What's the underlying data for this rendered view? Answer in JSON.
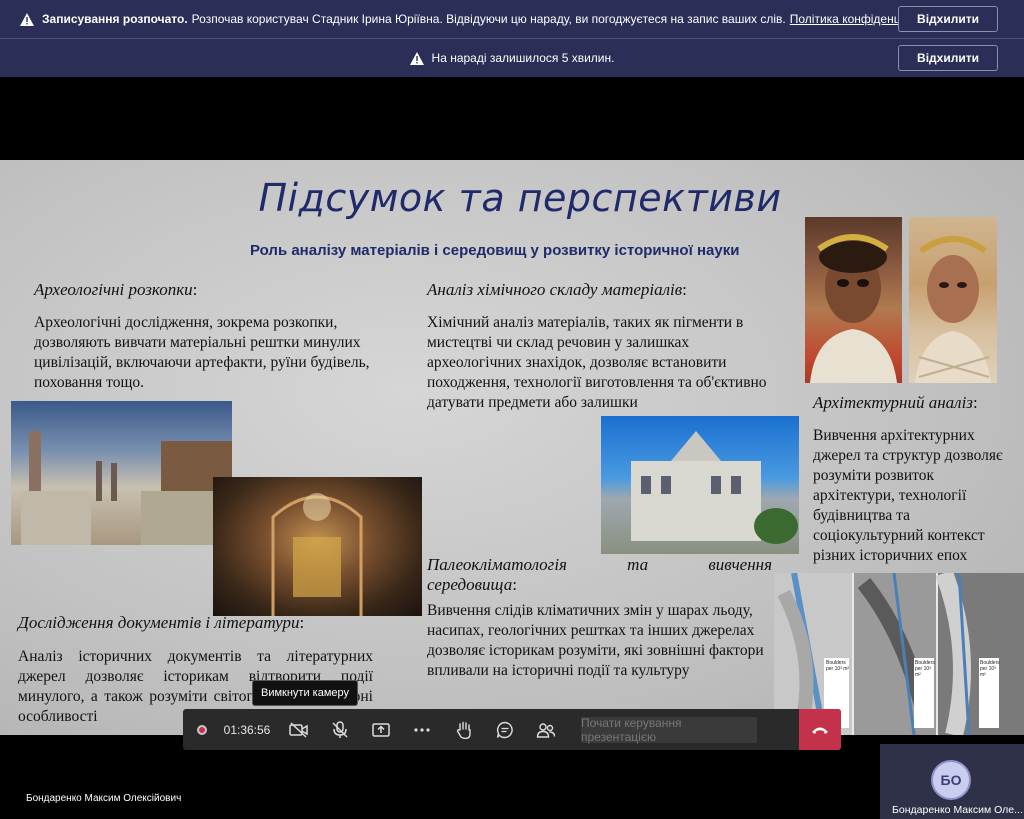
{
  "banner_recording": {
    "bold": "Записування розпочато.",
    "text": "Розпочав користувач Стадник Ірина Юріївна. Відвідуючи цю нараду, ви погоджуєтеся на запис ваших слів.",
    "link": "Політика конфіденційності",
    "dismiss": "Відхилити"
  },
  "banner_time": {
    "text": "На нараді залишилося 5 хвилин.",
    "dismiss": "Відхилити"
  },
  "slide": {
    "title": "Підсумок та перспективи",
    "subtitle": "Роль аналізу матеріалів і середовищ у розвитку історичної науки",
    "s1_heading": "Археологічні розкопки",
    "s1_colon": ":",
    "s1_text": "Археологічні дослідження, зокрема розкопки, дозволяють вивчати матеріальні рештки минулих цивілізацій, включаючи артефакти, руїни будівель, поховання тощо.",
    "s2_heading": "Аналіз хімічного складу матеріалів",
    "s2_colon": ":",
    "s2_text": "Хімічний аналіз матеріалів, таких як пігменти в мистецтві чи склад речовин у залишках археологічних знахідок, дозволяє встановити походження, технології виготовлення та об'єктивно датувати предмети або залишки",
    "s3_heading": "Архітектурний аналіз",
    "s3_colon": ":",
    "s3_text": "Вивчення архітектурних джерел та структур дозволяє розуміти розвиток архітектури, технології будівництва та соціокультурний контекст різних історичних епох",
    "s4_heading_a": "Палеокліматологія",
    "s4_heading_b": "та",
    "s4_heading_c": "вивчення",
    "s4_heading_d": "середовища",
    "s4_colon": ":",
    "s4_text": "Вивчення слідів кліматичних змін у шарах льоду, насипах, геологічних рештках та інших джерелах дозволяє історикам розуміти, які зовнішні фактори впливали на історичні події та культуру",
    "s5_heading": "Дослідження документів і літератури",
    "s5_colon": ":",
    "s5_text": "Аналіз історичних документів та літературних джерел дозволяє історикам відтворити події минулого, а також розуміти світогляди та культурні особливості",
    "glacier_labels": [
      "Boulders per 10³ m²",
      "Boulders per 10³ m²",
      "Boulders per 10³ m²"
    ]
  },
  "toolbar": {
    "timer": "01:36:56",
    "present_placeholder": "Почати керування презентацією",
    "tooltip": "Вимкнути камеру"
  },
  "participants": {
    "left_name": "Бондаренко Максим Олексійович",
    "self_initials": "БО",
    "self_name": "Бондаренко Максим Оле..."
  },
  "colors": {
    "banner_bg": "#2b2f57",
    "title_blue": "#1f2a6a",
    "hangup_red": "#c4314b"
  }
}
